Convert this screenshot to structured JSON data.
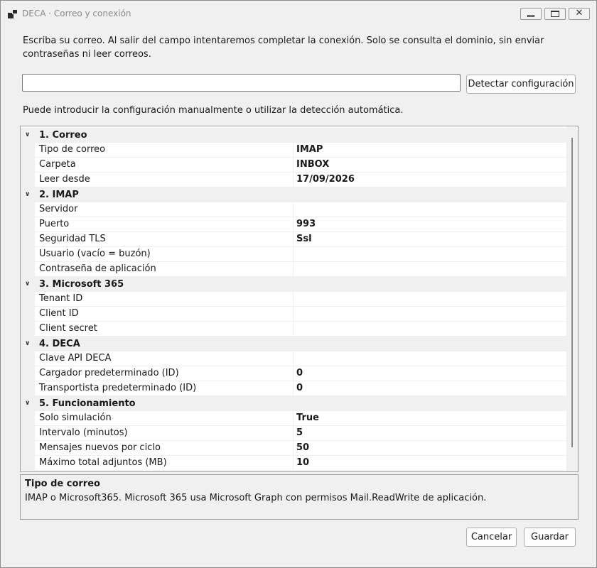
{
  "window": {
    "title": "DECA · Correo y conexión",
    "close_glyph": "✕"
  },
  "intro": "Escriba su correo. Al salir del campo intentaremos completar la conexión. Solo se consulta el dominio, sin enviar contraseñas ni leer correos.",
  "email": {
    "value": "",
    "placeholder": ""
  },
  "detect_label": "Detectar configuración",
  "manual_text": "Puede introducir la configuración manualmente o utilizar la detección automática.",
  "categories": [
    {
      "label": "1. Correo",
      "props": [
        {
          "name": "Tipo de correo",
          "value": "IMAP"
        },
        {
          "name": "Carpeta",
          "value": "INBOX"
        },
        {
          "name": "Leer desde",
          "value": "17/09/2026"
        }
      ]
    },
    {
      "label": "2. IMAP",
      "props": [
        {
          "name": "Servidor",
          "value": ""
        },
        {
          "name": "Puerto",
          "value": "993"
        },
        {
          "name": "Seguridad TLS",
          "value": "Ssl"
        },
        {
          "name": "Usuario (vacío = buzón)",
          "value": ""
        },
        {
          "name": "Contraseña de aplicación",
          "value": ""
        }
      ]
    },
    {
      "label": "3. Microsoft 365",
      "props": [
        {
          "name": "Tenant ID",
          "value": ""
        },
        {
          "name": "Client ID",
          "value": ""
        },
        {
          "name": "Client secret",
          "value": ""
        }
      ]
    },
    {
      "label": "4. DECA",
      "props": [
        {
          "name": "Clave API DECA",
          "value": ""
        },
        {
          "name": "Cargador predeterminado (ID)",
          "value": "0"
        },
        {
          "name": "Transportista predeterminado (ID)",
          "value": "0"
        }
      ]
    },
    {
      "label": "5. Funcionamiento",
      "props": [
        {
          "name": "Solo simulación",
          "value": "True"
        },
        {
          "name": "Intervalo (minutos)",
          "value": "5"
        },
        {
          "name": "Mensajes nuevos por ciclo",
          "value": "50"
        },
        {
          "name": "Máximo total adjuntos (MB)",
          "value": "10"
        }
      ]
    }
  ],
  "description": {
    "title": "Tipo de correo",
    "text": "IMAP o Microsoft365. Microsoft 365 usa Microsoft Graph con permisos Mail.ReadWrite de aplicación."
  },
  "buttons": {
    "cancel": "Cancelar",
    "save": "Guardar"
  }
}
